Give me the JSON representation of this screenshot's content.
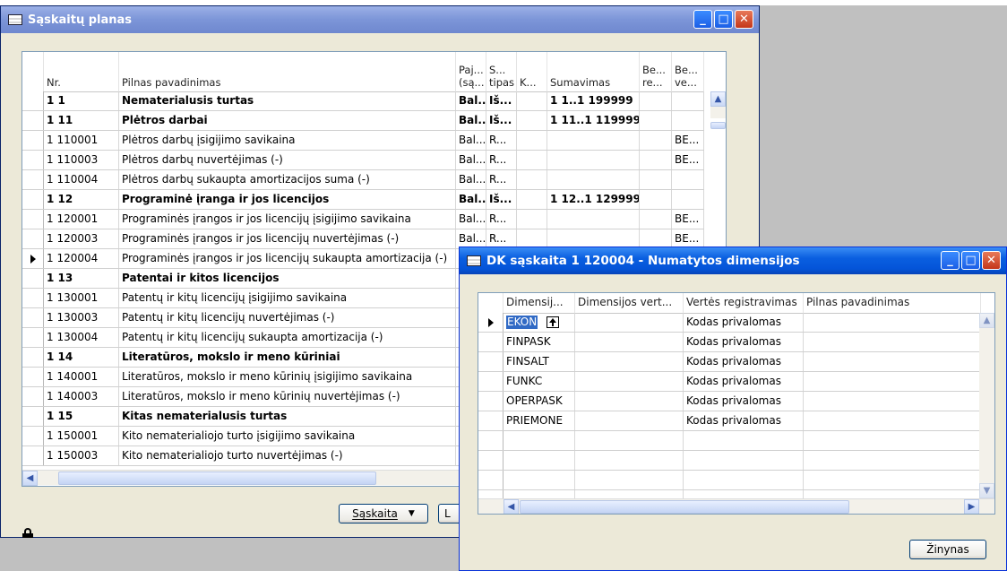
{
  "main_window": {
    "title": "Sąskaitų planas",
    "columns": [
      "Nr.",
      "Pilnas pavadinimas",
      "Paj... (są...",
      "S... tipas",
      "K...",
      "Sumavimas",
      "Be... re...",
      "Be... ve..."
    ],
    "rows": [
      {
        "nr": "1 1",
        "name": "Nematerialusis turtas",
        "paj": "Bal...",
        "tipas": "Iš...",
        "k": "",
        "sum": "1 1..1 199999",
        "be1": "",
        "be2": "",
        "bold": true,
        "selected": false
      },
      {
        "nr": "1 11",
        "name": "Plėtros darbai",
        "paj": "Bal...",
        "tipas": "Iš...",
        "k": "",
        "sum": "1 11..1 119999",
        "be1": "",
        "be2": "",
        "bold": true,
        "selected": false
      },
      {
        "nr": "1 110001",
        "name": "Plėtros darbų įsigijimo savikaina",
        "paj": "Bal...",
        "tipas": "R...",
        "k": "",
        "sum": "",
        "be1": "",
        "be2": "BE...",
        "bold": false,
        "selected": false
      },
      {
        "nr": "1 110003",
        "name": "Plėtros darbų nuvertėjimas (-)",
        "paj": "Bal...",
        "tipas": "R...",
        "k": "",
        "sum": "",
        "be1": "",
        "be2": "BE...",
        "bold": false,
        "selected": false
      },
      {
        "nr": "1 110004",
        "name": "Plėtros darbų sukaupta amortizacijos suma (-)",
        "paj": "Bal...",
        "tipas": "R...",
        "k": "",
        "sum": "",
        "be1": "",
        "be2": "",
        "bold": false,
        "selected": false
      },
      {
        "nr": "1 12",
        "name": "Programinė įranga ir jos licencijos",
        "paj": "Bal...",
        "tipas": "Iš...",
        "k": "",
        "sum": "1 12..1 129999",
        "be1": "",
        "be2": "",
        "bold": true,
        "selected": false
      },
      {
        "nr": "1 120001",
        "name": "Programinės įrangos ir jos licencijų įsigijimo savikaina",
        "paj": "Bal...",
        "tipas": "R...",
        "k": "",
        "sum": "",
        "be1": "",
        "be2": "BE...",
        "bold": false,
        "selected": false
      },
      {
        "nr": "1 120003",
        "name": "Programinės įrangos ir jos licencijų nuvertėjimas (-)",
        "paj": "Bal...",
        "tipas": "R...",
        "k": "",
        "sum": "",
        "be1": "",
        "be2": "BE...",
        "bold": false,
        "selected": false
      },
      {
        "nr": "1 120004",
        "name": "Programinės įrangos ir jos licencijų sukaupta amortizacija (-)",
        "paj": "B",
        "tipas": "",
        "k": "",
        "sum": "",
        "be1": "",
        "be2": "",
        "bold": false,
        "selected": true
      },
      {
        "nr": "1 13",
        "name": "Patentai ir kitos licencijos",
        "paj": "B",
        "tipas": "",
        "k": "",
        "sum": "",
        "be1": "",
        "be2": "",
        "bold": true,
        "selected": false
      },
      {
        "nr": "1 130001",
        "name": "Patentų ir kitų licencijų įsigijimo savikaina",
        "paj": "B",
        "tipas": "",
        "k": "",
        "sum": "",
        "be1": "",
        "be2": "",
        "bold": false,
        "selected": false
      },
      {
        "nr": "1 130003",
        "name": "Patentų ir kitų licencijų nuvertėjimas (-)",
        "paj": "B",
        "tipas": "",
        "k": "",
        "sum": "",
        "be1": "",
        "be2": "",
        "bold": false,
        "selected": false
      },
      {
        "nr": "1 130004",
        "name": "Patentų ir kitų licencijų sukaupta amortizacija (-)",
        "paj": "B",
        "tipas": "",
        "k": "",
        "sum": "",
        "be1": "",
        "be2": "",
        "bold": false,
        "selected": false
      },
      {
        "nr": "1 14",
        "name": "Literatūros, mokslo ir meno kūriniai",
        "paj": "B",
        "tipas": "",
        "k": "",
        "sum": "",
        "be1": "",
        "be2": "",
        "bold": true,
        "selected": false
      },
      {
        "nr": "1 140001",
        "name": "Literatūros, mokslo ir meno kūrinių įsigijimo savikaina",
        "paj": "B",
        "tipas": "",
        "k": "",
        "sum": "",
        "be1": "",
        "be2": "",
        "bold": false,
        "selected": false
      },
      {
        "nr": "1 140003",
        "name": "Literatūros, mokslo ir meno kūrinių nuvertėjimas (-)",
        "paj": "B",
        "tipas": "",
        "k": "",
        "sum": "",
        "be1": "",
        "be2": "",
        "bold": false,
        "selected": false
      },
      {
        "nr": "1 15",
        "name": "Kitas nematerialusis turtas",
        "paj": "B",
        "tipas": "",
        "k": "",
        "sum": "",
        "be1": "",
        "be2": "",
        "bold": true,
        "selected": false
      },
      {
        "nr": "1 150001",
        "name": "Kito nematerialiojo turto įsigijimo savikaina",
        "paj": "B",
        "tipas": "",
        "k": "",
        "sum": "",
        "be1": "",
        "be2": "",
        "bold": false,
        "selected": false
      },
      {
        "nr": "1 150003",
        "name": "Kito nematerialiojo turto nuvertėjimas (-)",
        "paj": "B",
        "tipas": "",
        "k": "",
        "sum": "",
        "be1": "",
        "be2": "",
        "bold": false,
        "selected": false
      }
    ],
    "account_button": "Sąskaita",
    "hidden_button_partial": "L"
  },
  "dim_window": {
    "title": "DK sąskaita 1 120004 - Numatytos dimensijos",
    "columns": [
      "Dimensij...",
      "Dimensijos vert...",
      "Vertės registravimas",
      "Pilnas pavadinimas"
    ],
    "rows": [
      {
        "dim": "EKON",
        "val": "",
        "reg": "Kodas privalomas",
        "name": "",
        "selected": true
      },
      {
        "dim": "FINPASK",
        "val": "",
        "reg": "Kodas privalomas",
        "name": "",
        "selected": false
      },
      {
        "dim": "FINSALT",
        "val": "",
        "reg": "Kodas privalomas",
        "name": "",
        "selected": false
      },
      {
        "dim": "FUNKC",
        "val": "",
        "reg": "Kodas privalomas",
        "name": "",
        "selected": false
      },
      {
        "dim": "OPERPASK",
        "val": "",
        "reg": "Kodas privalomas",
        "name": "",
        "selected": false
      },
      {
        "dim": "PRIEMONE",
        "val": "",
        "reg": "Kodas privalomas",
        "name": "",
        "selected": false
      },
      {
        "dim": "",
        "val": "",
        "reg": "",
        "name": "",
        "selected": false
      },
      {
        "dim": "",
        "val": "",
        "reg": "",
        "name": "",
        "selected": false
      },
      {
        "dim": "",
        "val": "",
        "reg": "",
        "name": "",
        "selected": false
      },
      {
        "dim": "",
        "val": "",
        "reg": "",
        "name": "",
        "selected": false
      }
    ],
    "help_button": "Žinynas"
  },
  "window_buttons": {
    "minimize": "_",
    "maximize": "□",
    "close": "✕"
  }
}
